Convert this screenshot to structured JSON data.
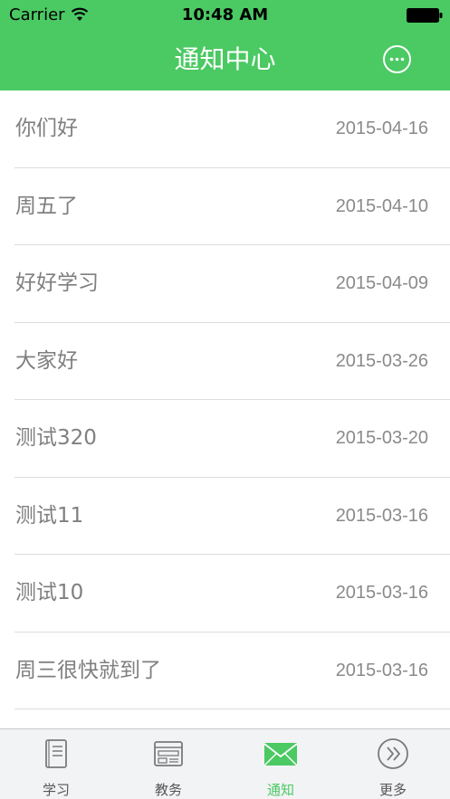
{
  "status_bar": {
    "carrier": "Carrier",
    "time": "10:48 AM"
  },
  "nav": {
    "title": "通知中心",
    "more_icon": "ellipsis-circle-icon"
  },
  "notices": [
    {
      "title": "你们好",
      "date": "2015-04-16"
    },
    {
      "title": "周五了",
      "date": "2015-04-10"
    },
    {
      "title": "好好学习",
      "date": "2015-04-09"
    },
    {
      "title": "大家好",
      "date": "2015-03-26"
    },
    {
      "title": "测试320",
      "date": "2015-03-20"
    },
    {
      "title": "测试11",
      "date": "2015-03-16"
    },
    {
      "title": "测试10",
      "date": "2015-03-16"
    },
    {
      "title": "周三很快就到了",
      "date": "2015-03-16"
    }
  ],
  "tabbar": {
    "active": "通知",
    "tabs": [
      {
        "label": "学习",
        "icon": "book-icon"
      },
      {
        "label": "教务",
        "icon": "newspaper-icon"
      },
      {
        "label": "通知",
        "icon": "envelope-icon"
      },
      {
        "label": "更多",
        "icon": "double-chevron-circle-icon"
      }
    ]
  },
  "colors": {
    "brand_green": "#4bc963",
    "tab_inactive": "#7a7a7a",
    "text_gray": "#7f7f7f"
  }
}
